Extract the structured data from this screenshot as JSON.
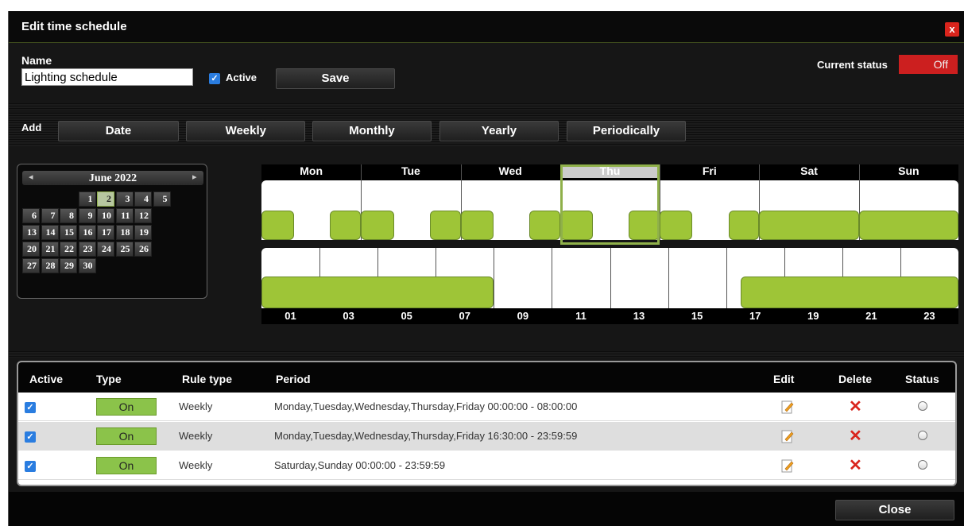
{
  "window": {
    "title": "Edit time schedule",
    "close_glyph": "x"
  },
  "form": {
    "name_label": "Name",
    "name_value": "Lighting schedule",
    "active_label": "Active",
    "save_label": "Save",
    "current_status_label": "Current status",
    "current_status_value": "Off"
  },
  "add": {
    "label": "Add",
    "buttons": [
      "Date",
      "Weekly",
      "Monthly",
      "Yearly",
      "Periodically"
    ]
  },
  "calendar": {
    "month": "June 2022",
    "prev": "◂",
    "next": "▸",
    "selected_day": 2,
    "weeks": [
      [
        "",
        "",
        "",
        "1",
        "2",
        "3",
        "4",
        "5"
      ],
      [
        "6",
        "7",
        "8",
        "9",
        "10",
        "11",
        "12"
      ],
      [
        "13",
        "14",
        "15",
        "16",
        "17",
        "18",
        "19"
      ],
      [
        "20",
        "21",
        "22",
        "23",
        "24",
        "25",
        "26"
      ],
      [
        "27",
        "28",
        "29",
        "30",
        "",
        "",
        ""
      ]
    ]
  },
  "weekview": {
    "days": [
      "Mon",
      "Tue",
      "Wed",
      "Thu",
      "Fri",
      "Sat",
      "Sun"
    ],
    "highlighted": "Thu",
    "on_fractions": {
      "Mon": [
        [
          0,
          0.33
        ],
        [
          0.69,
          1
        ]
      ],
      "Tue": [
        [
          0,
          0.33
        ],
        [
          0.69,
          1
        ]
      ],
      "Wed": [
        [
          0,
          0.33
        ],
        [
          0.69,
          1
        ]
      ],
      "Thu": [
        [
          0,
          0.33
        ],
        [
          0.69,
          1
        ]
      ],
      "Fri": [
        [
          0,
          0.33
        ],
        [
          0.69,
          1
        ]
      ],
      "Sat": [
        [
          0,
          1
        ]
      ],
      "Sun": [
        [
          0,
          1
        ]
      ]
    }
  },
  "dayview": {
    "hour_labels": [
      "01",
      "03",
      "05",
      "07",
      "09",
      "11",
      "13",
      "15",
      "17",
      "19",
      "21",
      "23"
    ],
    "on_hours": [
      [
        0,
        8
      ],
      [
        16.5,
        24
      ]
    ]
  },
  "table": {
    "headers": {
      "active": "Active",
      "type": "Type",
      "rule_type": "Rule type",
      "period": "Period",
      "edit": "Edit",
      "delete": "Delete",
      "status": "Status"
    },
    "rows": [
      {
        "type": "On",
        "rule_type": "Weekly",
        "period": "Monday,Tuesday,Wednesday,Thursday,Friday 00:00:00 - 08:00:00"
      },
      {
        "type": "On",
        "rule_type": "Weekly",
        "period": "Monday,Tuesday,Wednesday,Thursday,Friday 16:30:00 - 23:59:59"
      },
      {
        "type": "On",
        "rule_type": "Weekly",
        "period": "Saturday,Sunday 00:00:00 - 23:59:59"
      }
    ]
  },
  "footer": {
    "close_label": "Close"
  },
  "colors": {
    "accent_green": "#9ec537",
    "status_off": "#cc1f1f",
    "checkbox_blue": "#2a7de0"
  }
}
